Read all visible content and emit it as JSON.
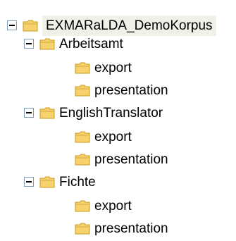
{
  "tree": {
    "root": {
      "label": "EXMARaLDA_DemoKorpus"
    },
    "groups": [
      {
        "label": "Arbeitsamt",
        "children": [
          "export",
          "presentation"
        ]
      },
      {
        "label": "EnglishTranslator",
        "children": [
          "export",
          "presentation"
        ]
      },
      {
        "label": "Fichte",
        "children": [
          "export",
          "presentation"
        ]
      }
    ]
  },
  "colors": {
    "folder_fill": "#f6d26e",
    "folder_stroke": "#c89b1e",
    "toggle_border": "#7f9db9"
  },
  "icons": {
    "folder": "folder-icon",
    "collapse": "minus-box-icon"
  }
}
